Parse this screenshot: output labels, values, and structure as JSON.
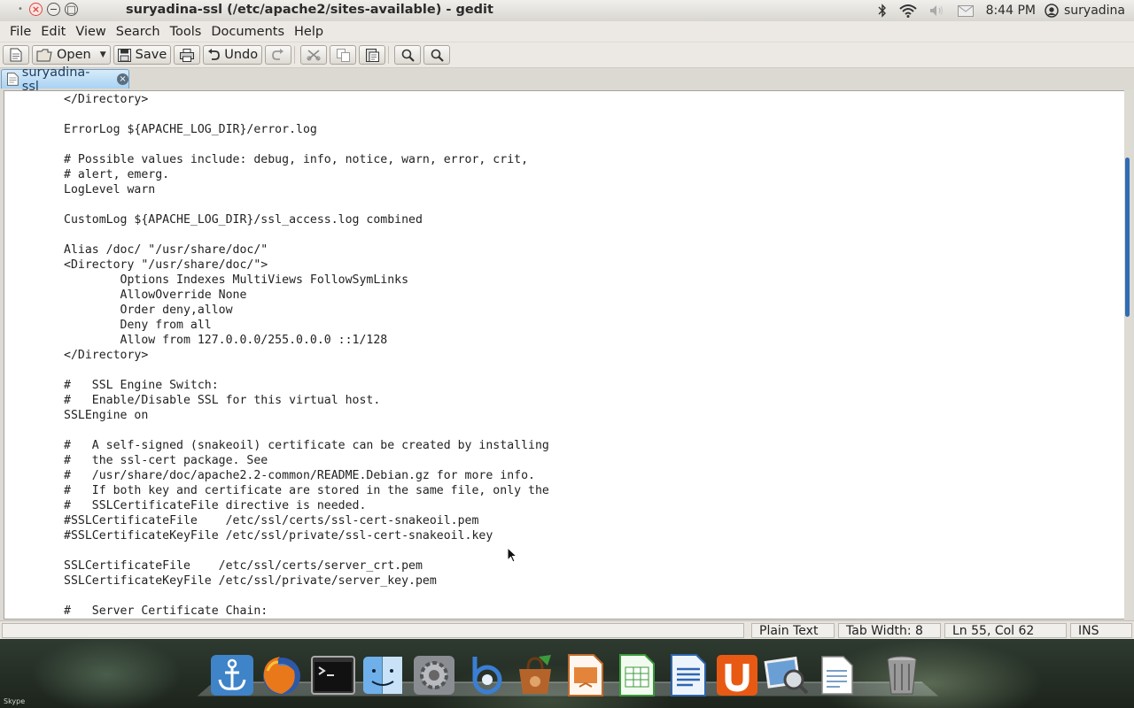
{
  "window": {
    "title": "suryadina-ssl (/etc/apache2/sites-available) - gedit"
  },
  "tray": {
    "icons": [
      "bluetooth-icon",
      "wifi-icon",
      "volume-icon",
      "mail-icon",
      "user-icon"
    ],
    "clock": "8:44 PM",
    "user": "suryadina"
  },
  "menu": {
    "items": [
      "File",
      "Edit",
      "View",
      "Search",
      "Tools",
      "Documents",
      "Help"
    ]
  },
  "toolbar": {
    "open_label": "Open",
    "save_label": "Save",
    "undo_label": "Undo"
  },
  "tab": {
    "label": "suryadina-ssl"
  },
  "editor": {
    "lines": [
      "</Directory>",
      "",
      "ErrorLog ${APACHE_LOG_DIR}/error.log",
      "",
      "# Possible values include: debug, info, notice, warn, error, crit,",
      "# alert, emerg.",
      "LogLevel warn",
      "",
      "CustomLog ${APACHE_LOG_DIR}/ssl_access.log combined",
      "",
      "Alias /doc/ \"/usr/share/doc/\"",
      "<Directory \"/usr/share/doc/\">",
      "        Options Indexes MultiViews FollowSymLinks",
      "        AllowOverride None",
      "        Order deny,allow",
      "        Deny from all",
      "        Allow from 127.0.0.0/255.0.0.0 ::1/128",
      "</Directory>",
      "",
      "#   SSL Engine Switch:",
      "#   Enable/Disable SSL for this virtual host.",
      "SSLEngine on",
      "",
      "#   A self-signed (snakeoil) certificate can be created by installing",
      "#   the ssl-cert package. See",
      "#   /usr/share/doc/apache2.2-common/README.Debian.gz for more info.",
      "#   If both key and certificate are stored in the same file, only the",
      "#   SSLCertificateFile directive is needed.",
      "#SSLCertificateFile    /etc/ssl/certs/ssl-cert-snakeoil.pem",
      "#SSLCertificateKeyFile /etc/ssl/private/ssl-cert-snakeoil.key",
      "",
      "SSLCertificateFile    /etc/ssl/certs/server_crt.pem",
      "SSLCertificateKeyFile /etc/ssl/private/server_key.pem",
      "",
      "#   Server Certificate Chain:"
    ]
  },
  "statusbar": {
    "language": "Plain Text",
    "tab_width": "Tab Width:  8",
    "position": "Ln 55, Col 62",
    "mode": "INS"
  },
  "dock": {
    "apps": [
      "anchor-icon",
      "firefox-icon",
      "terminal-icon",
      "finder-icon",
      "settings-icon",
      "bluefish-icon",
      "bag-icon",
      "presentation-icon",
      "spreadsheet-icon",
      "writer-icon",
      "ubuntu-one-icon",
      "image-viewer-icon",
      "document-viewer-icon",
      "trash-icon"
    ]
  },
  "watermark": "Skype"
}
